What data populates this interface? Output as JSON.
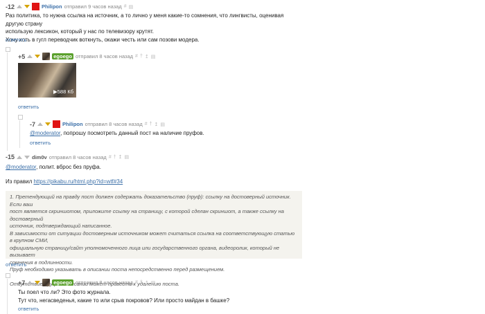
{
  "c1": {
    "rating": "-12",
    "author": "Philipon",
    "time": "отправил 9 часов назад",
    "lines": [
      "Раз политика, то нужна ссылка на источник, а то лично у меня какие-то сомнения, что лингвисты, оценивая другую страну",
      "использую лексикон, который у нас по телевизору крутят.",
      "Хочу хоть в гугл переводчик воткнуть, окажи честь или сам позови модера."
    ],
    "reply": "ответить"
  },
  "c2": {
    "rating": "+5",
    "author": "egoego",
    "time": "отправил 8 часов назад",
    "thumb_size": "588 Кб",
    "reply": "ответить"
  },
  "c3": {
    "rating": "-7",
    "author": "Philipon",
    "time": "отправил 8 часов назад",
    "mention": "@moderator",
    "text": ", попрошу посмотреть данный пост на наличие пруфов.",
    "reply": "ответить"
  },
  "c4": {
    "rating": "-15",
    "author": "dim0v",
    "time": "отправил 8 часов назад",
    "mention": "@moderator",
    "text": ", полит. вброс без пруфа.",
    "rules_prefix": "Из правил ",
    "rules_link": "https://pikabu.ru/html.php?id=wtf#34",
    "quote": [
      "1. Претендующий на правду пост должен содержать доказательство (пруф): ссылку на достоверный источник. Если ваш",
      "пост является скриншотом, приложите ссылку на страницу, с которой сделан скриншот, а также ссылку на достоверный",
      "источник, подтверждающий написанное.",
      "В зависимости от ситуации достоверным источником может считаться ссылка на соответствующую статью в крупном СМИ,",
      "официальную страницу/сайт уполномоченного лица или государственного органа, видеоролик, который не вызывает",
      "сомнения в подлинности.",
      "Пруф необходимо указывать в описании поста непосредственно перед размещением.",
      "",
      "Отсутствие пруфа в описании может привести к удалению поста."
    ],
    "reply": "ответить"
  },
  "c5": {
    "rating": "+7",
    "author": "egoego",
    "time": "отправил 8 часов назад",
    "lines": [
      "Ты поел что ли? Это фото журнала.",
      "Тут что, негасведенья, какие то или срыв покровов? Или просто майдан в башке?"
    ],
    "reply": "ответить"
  }
}
